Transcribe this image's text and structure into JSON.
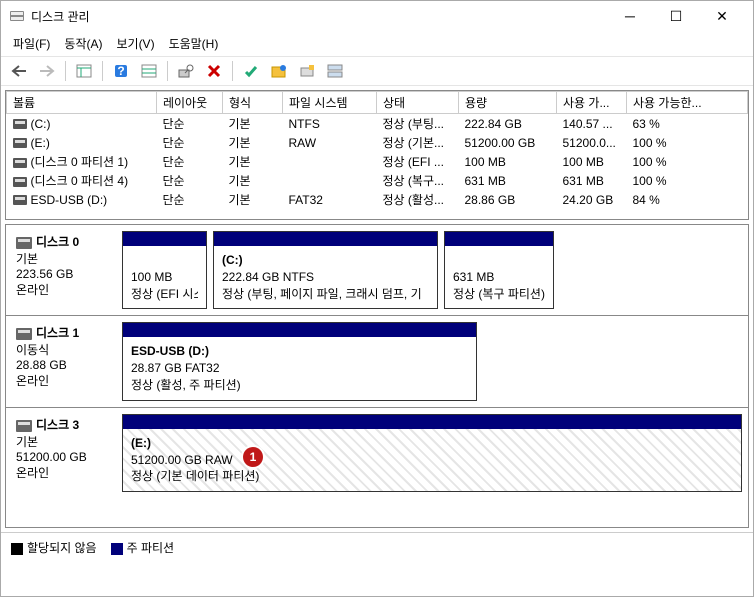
{
  "window": {
    "title": "디스크 관리"
  },
  "menu": {
    "file": "파일(F)",
    "action": "동작(A)",
    "view": "보기(V)",
    "help": "도움말(H)"
  },
  "columns": {
    "volume": "볼륨",
    "layout": "레이아웃",
    "type": "형식",
    "fs": "파일 시스템",
    "status": "상태",
    "capacity": "용량",
    "free": "사용 가...",
    "freepct": "사용 가능한..."
  },
  "volumes": [
    {
      "name": "(C:)",
      "layout": "단순",
      "type": "기본",
      "fs": "NTFS",
      "status": "정상 (부팅...",
      "capacity": "222.84 GB",
      "free": "140.57 ...",
      "pct": "63 %"
    },
    {
      "name": "(E:)",
      "layout": "단순",
      "type": "기본",
      "fs": "RAW",
      "status": "정상 (기본...",
      "capacity": "51200.00 GB",
      "free": "51200.0...",
      "pct": "100 %"
    },
    {
      "name": "(디스크 0 파티션 1)",
      "layout": "단순",
      "type": "기본",
      "fs": "",
      "status": "정상 (EFI ...",
      "capacity": "100 MB",
      "free": "100 MB",
      "pct": "100 %"
    },
    {
      "name": "(디스크 0 파티션 4)",
      "layout": "단순",
      "type": "기본",
      "fs": "",
      "status": "정상 (복구...",
      "capacity": "631 MB",
      "free": "631 MB",
      "pct": "100 %"
    },
    {
      "name": "ESD-USB (D:)",
      "layout": "단순",
      "type": "기본",
      "fs": "FAT32",
      "status": "정상 (활성...",
      "capacity": "28.86 GB",
      "free": "24.20 GB",
      "pct": "84 %"
    }
  ],
  "disks": {
    "d0": {
      "title": "디스크 0",
      "type": "기본",
      "size": "223.56 GB",
      "state": "온라인",
      "p1": {
        "size": "100 MB",
        "status": "정상 (EFI 시스"
      },
      "p2": {
        "title": "(C:)",
        "line1": "222.84 GB NTFS",
        "line2": "정상 (부팅, 페이지 파일, 크래시 덤프, 기"
      },
      "p3": {
        "size": "631 MB",
        "status": "정상 (복구 파티션)"
      }
    },
    "d1": {
      "title": "디스크 1",
      "type": "이동식",
      "size": "28.88 GB",
      "state": "온라인",
      "p1": {
        "title": "ESD-USB  (D:)",
        "line1": "28.87 GB FAT32",
        "line2": "정상 (활성, 주 파티션)"
      }
    },
    "d3": {
      "title": "디스크 3",
      "type": "기본",
      "size": "51200.00 GB",
      "state": "온라인",
      "p1": {
        "title": "(E:)",
        "line1": "51200.00 GB RAW",
        "line2": "정상 (기본 데이터 파티션)"
      }
    }
  },
  "legend": {
    "unallocated": "할당되지 않음",
    "primary": "주 파티션"
  },
  "badge": "1"
}
